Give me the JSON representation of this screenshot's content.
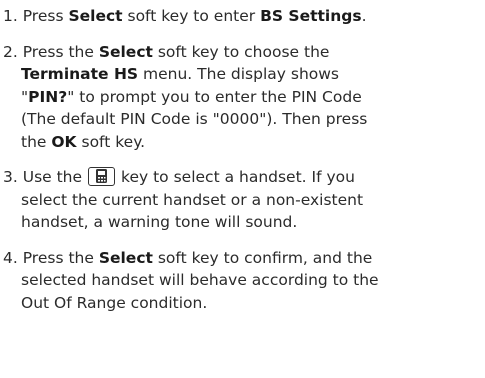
{
  "steps": [
    {
      "number": "1.",
      "segments": [
        {
          "text": " Press ",
          "bold": false
        },
        {
          "text": "Select",
          "bold": true
        },
        {
          "text": " soft key to enter ",
          "bold": false
        },
        {
          "text": "BS Settings",
          "bold": true
        },
        {
          "text": ".",
          "bold": false
        }
      ]
    },
    {
      "number": "2.",
      "p1": " Press the ",
      "b1": "Select",
      "p2": " soft key to choose the",
      "b2": "Terminate HS",
      "p3": " menu. The display shows",
      "q1": "\"",
      "b3": "PIN?",
      "p4": "\" to prompt you to enter the PIN Code",
      "p5": "(The default PIN Code is \"0000\"). Then press",
      "p6": "the ",
      "b4": "OK",
      "p7": " soft key."
    },
    {
      "number": "3.",
      "p1": " Use the",
      "icon": "handset-key-icon",
      "p2": "key to select a handset. If you",
      "p3": "select the current handset or a non-existent",
      "p4": "handset, a warning tone will sound."
    },
    {
      "number": "4.",
      "p1": " Press the ",
      "b1": "Select",
      "p2": " soft key to confirm, and the",
      "p3": "selected handset will behave according to the",
      "p4": "Out Of Range condition."
    }
  ]
}
